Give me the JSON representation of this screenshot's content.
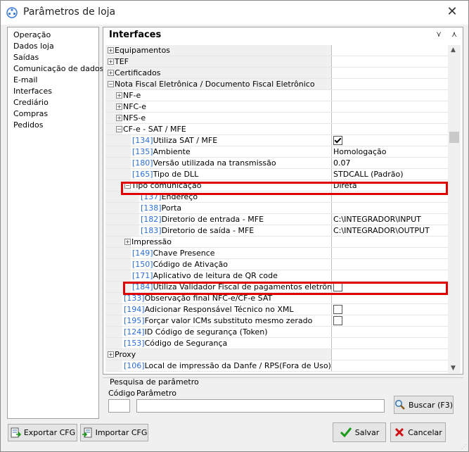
{
  "window": {
    "title": "Parâmetros de loja"
  },
  "nav": {
    "items": [
      "Operação",
      "Dados loja",
      "Saídas",
      "Comunicação de dados",
      "E-mail",
      "Interfaces",
      "Crediário",
      "Compras",
      "Pedidos"
    ]
  },
  "panel": {
    "title": "Interfaces"
  },
  "rows": [
    {
      "code": "",
      "label": "Equipamentos",
      "exp": "+",
      "level": 0,
      "value": ""
    },
    {
      "code": "",
      "label": "TEF",
      "exp": "+",
      "level": 0,
      "value": ""
    },
    {
      "code": "",
      "label": "Certificados",
      "exp": "+",
      "level": 0,
      "value": ""
    },
    {
      "code": "",
      "label": "Nota Fiscal Eletrônica / Documento Fiscal Eletrônico",
      "exp": "−",
      "level": 0,
      "value": ""
    },
    {
      "code": "",
      "label": "NF-e",
      "exp": "+",
      "level": 1,
      "value": ""
    },
    {
      "code": "",
      "label": "NFC-e",
      "exp": "+",
      "level": 1,
      "value": ""
    },
    {
      "code": "",
      "label": "NFS-e",
      "exp": "+",
      "level": 1,
      "value": ""
    },
    {
      "code": "",
      "label": "CF-e - SAT / MFE",
      "exp": "−",
      "level": 1,
      "value": ""
    },
    {
      "code": "[134]",
      "label": "Utiliza SAT / MFE",
      "exp": "",
      "level": 2,
      "value": "",
      "check": true
    },
    {
      "code": "[135]",
      "label": "Ambiente",
      "exp": "",
      "level": 2,
      "value": "Homologação"
    },
    {
      "code": "[180]",
      "label": "Versão utilizada na transmissão",
      "exp": "",
      "level": 2,
      "value": "0.07"
    },
    {
      "code": "[165]",
      "label": "Tipo de DLL",
      "exp": "",
      "level": 2,
      "value": "STDCALL (Padrão)"
    },
    {
      "code": "",
      "label": "Tipo comunicação",
      "exp": "−",
      "level": 2,
      "value": "Direta"
    },
    {
      "code": "[137]",
      "label": "Endereço",
      "exp": "",
      "level": 3,
      "value": ""
    },
    {
      "code": "[138]",
      "label": "Porta",
      "exp": "",
      "level": 3,
      "value": ""
    },
    {
      "code": "[182]",
      "label": "Diretorio de entrada - MFE",
      "exp": "",
      "level": 3,
      "value": "C:\\INTEGRADOR\\INPUT"
    },
    {
      "code": "[183]",
      "label": "Diretorio de saída - MFE",
      "exp": "",
      "level": 3,
      "value": "C:\\INTEGRADOR\\OUTPUT"
    },
    {
      "code": "",
      "label": "Impressão",
      "exp": "+",
      "level": 2,
      "value": ""
    },
    {
      "code": "[149]",
      "label": "Chave Presence",
      "exp": "",
      "level": 2,
      "value": ""
    },
    {
      "code": "[150]",
      "label": "Código de Ativação",
      "exp": "",
      "level": 2,
      "value": ""
    },
    {
      "code": "[171]",
      "label": "Aplicativo de leitura de QR code",
      "exp": "",
      "level": 2,
      "value": ""
    },
    {
      "code": "[184]",
      "label": "Utiliza Validador Fiscal de pagamentos eletrônicos - Ve",
      "exp": "",
      "level": 2,
      "value": "",
      "check": false
    },
    {
      "code": "[133]",
      "label": "Observação final NFC-e/CF-e SAT",
      "exp": "",
      "level": 1,
      "value": ""
    },
    {
      "code": "[194]",
      "label": "Adicionar Responsável Técnico no XML",
      "exp": "",
      "level": 1,
      "value": "",
      "check": false
    },
    {
      "code": "[195]",
      "label": "Forçar valor ICMs substituto mesmo zerado",
      "exp": "",
      "level": 1,
      "value": "",
      "check": false
    },
    {
      "code": "[124]",
      "label": "ID Código de segurança (Token)",
      "exp": "",
      "level": 1,
      "value": ""
    },
    {
      "code": "[153]",
      "label": "Código de Segurança",
      "exp": "",
      "level": 1,
      "value": ""
    },
    {
      "code": "",
      "label": "Proxy",
      "exp": "+",
      "level": 0,
      "value": ""
    },
    {
      "code": "[106]",
      "label": "Local de impressão da Danfe / RPS(Fora de Uso)",
      "exp": "",
      "level": 1,
      "value": ""
    }
  ],
  "search": {
    "legend": "Pesquisa de parâmetro",
    "code_label": "Código",
    "param_label": "Parâmetro",
    "code_value": "",
    "param_value": "",
    "button": "Buscar (F3)"
  },
  "footer": {
    "export_label": "Exportar CFG",
    "import_label": "Importar CFG",
    "save_label": "Salvar",
    "cancel_label": "Cancelar"
  },
  "colors": {
    "code": "#2a6fd6",
    "highlight": "#e00000",
    "save_icon": "#1a9a1a",
    "cancel_icon": "#d01010"
  }
}
